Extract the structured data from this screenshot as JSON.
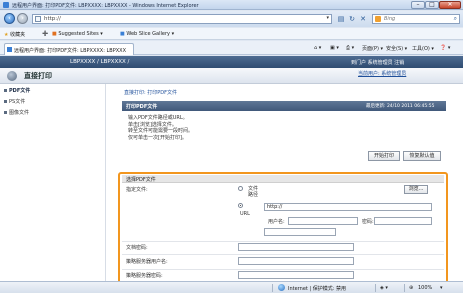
{
  "window": {
    "title": "远程用户界面: 打印PDF文件: LBPXXXX: LBPXXXX - Windows Internet Explorer",
    "min": "–",
    "max": "□",
    "close": "✕"
  },
  "addressbar": {
    "url": "http://",
    "dropdown": "▾",
    "refresh": "↻",
    "stop": "✕",
    "search_placeholder": "Bing"
  },
  "favorites": {
    "favorites_label": "收藏夹",
    "suggested_sites": "Suggested Sites ▾",
    "web_slice_gallery": "Web Slice Gallery ▾"
  },
  "tab": {
    "title": "远程用户界面: 打印PDF文件: LBPXXXX: LBPXXX"
  },
  "commandbar": {
    "page": "页面(P) ▾",
    "safety": "安全(S) ▾",
    "tools": "工具(O) ▾",
    "help": "❓ ▾"
  },
  "header": {
    "device": "LBPXXXX / LBPXXXX /",
    "links": "到门户  系统管理员 注销",
    "title": "直接打印",
    "user": "当前用户: 系统管理员"
  },
  "sidebar": {
    "items": [
      {
        "label": "PDF文件"
      },
      {
        "label": "PS文件"
      },
      {
        "label": "图像文件"
      }
    ]
  },
  "main": {
    "breadcrumb": "直接打印: 打印PDF文件",
    "panel_title": "打印PDF文件",
    "last_update": "最后更新: 24/10 2011 06:45:55",
    "instructions": [
      "输入PDF文件路径或URL。",
      "单击[浏览]选择文件。",
      "转至文件可能需要一段时间。",
      "仅可单击一次[开始打印]。"
    ],
    "start_print": "开始打印",
    "reset": "恢复默认值",
    "section_title": "选择PDF文件",
    "file_label": "指定文件:",
    "option_file": "文件路径",
    "browse": "浏览...",
    "option_url": "URL",
    "url_value": "http://",
    "username_label": "用户名:",
    "password_label": "密码:",
    "doc_password_label": "文档密码:",
    "proxy_user_label": "策略服务器用户名:",
    "proxy_pass_label": "策略服务器密码:"
  },
  "statusbar": {
    "zone": "Internet | 保护模式: 禁用",
    "zoom": "100%"
  }
}
